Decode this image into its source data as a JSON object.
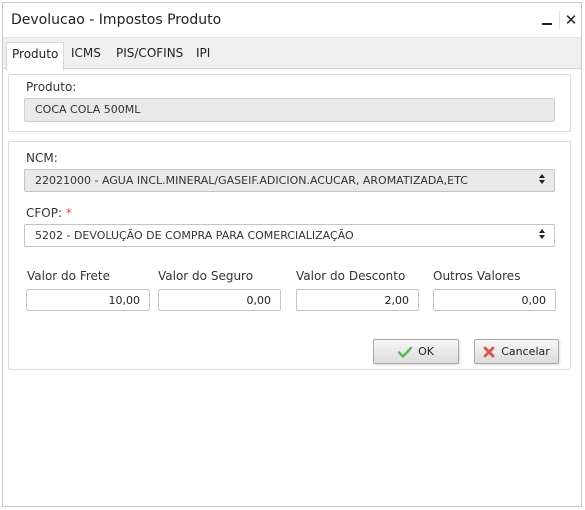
{
  "window": {
    "title": "Devolucao - Impostos Produto"
  },
  "tabs": [
    {
      "label": "Produto",
      "active": true
    },
    {
      "label": "ICMS",
      "active": false
    },
    {
      "label": "PIS/COFINS",
      "active": false
    },
    {
      "label": "IPI",
      "active": false
    }
  ],
  "produto": {
    "label": "Produto:",
    "value": "COCA COLA 500ML"
  },
  "ncm": {
    "label": "NCM:",
    "value": "22021000 - AGUA INCL.MINERAL/GASEIF.ADICION.ACUCAR, AROMATIZADA,ETC"
  },
  "cfop": {
    "label": "CFOP:",
    "required_mark": "*",
    "value": "5202 - DEVOLUÇÃO DE COMPRA PARA COMERCIALIZAÇÃO"
  },
  "valores": {
    "frete": {
      "label": "Valor do Frete",
      "value": "10,00"
    },
    "seguro": {
      "label": "Valor do Seguro",
      "value": "0,00"
    },
    "desconto": {
      "label": "Valor do Desconto",
      "value": "2,00"
    },
    "outros": {
      "label": "Outros Valores",
      "value": "0,00"
    }
  },
  "buttons": {
    "ok_label": "OK",
    "cancel_label": "Cancelar",
    "ok_icon": "check-icon",
    "cancel_icon": "x-icon"
  },
  "colors": {
    "required": "#d9534f",
    "check": "#5cb85c",
    "cancel_x": "#d9534f"
  }
}
